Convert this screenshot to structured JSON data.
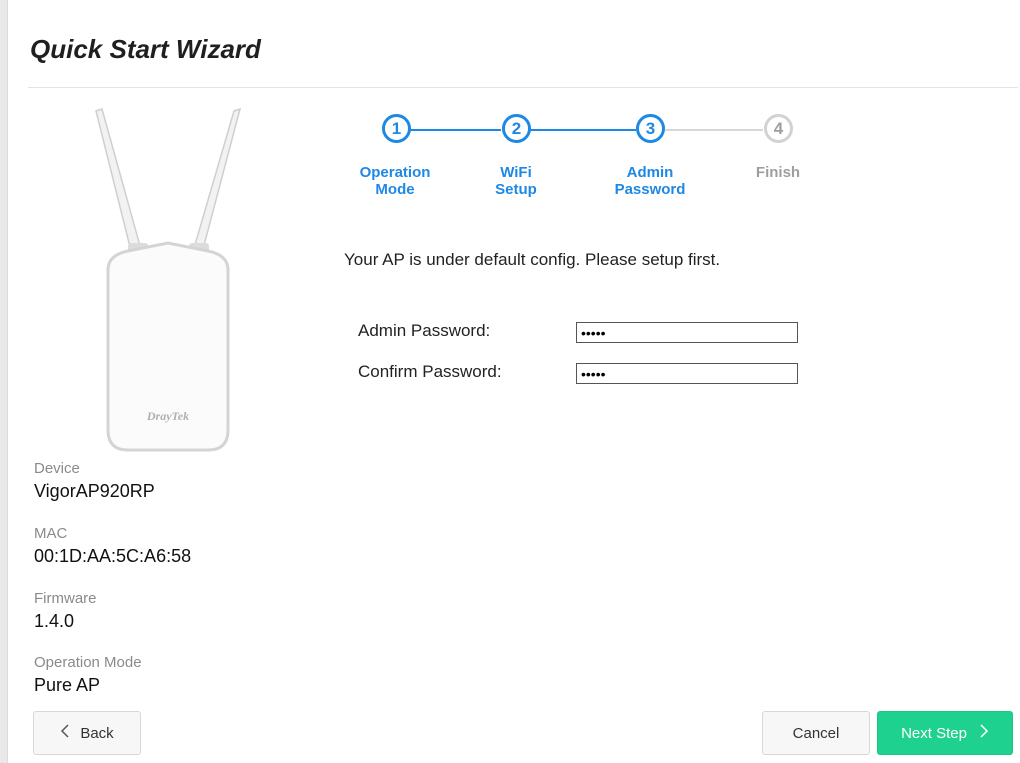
{
  "header": {
    "title": "Quick Start Wizard"
  },
  "device_image": {
    "brand": "DrayTek"
  },
  "info": [
    {
      "label": "Device",
      "value": "VigorAP920RP"
    },
    {
      "label": "MAC",
      "value": "00:1D:AA:5C:A6:58"
    },
    {
      "label": "Firmware",
      "value": "1.4.0"
    },
    {
      "label": "Operation Mode",
      "value": "Pure AP"
    }
  ],
  "steps": [
    {
      "number": "1",
      "label_line1": "Operation",
      "label_line2": "Mode",
      "state": "active"
    },
    {
      "number": "2",
      "label_line1": "WiFi",
      "label_line2": "Setup",
      "state": "active"
    },
    {
      "number": "3",
      "label_line1": "Admin",
      "label_line2": "Password",
      "state": "active"
    },
    {
      "number": "4",
      "label_line1": "Finish",
      "label_line2": "",
      "state": "inactive"
    }
  ],
  "intro": "Your AP is under default config. Please setup first.",
  "form": {
    "admin_password_label": "Admin Password:",
    "admin_password_value": "•••••",
    "confirm_password_label": "Confirm Password:",
    "confirm_password_value": "•••••"
  },
  "buttons": {
    "back": "Back",
    "cancel": "Cancel",
    "next": "Next Step"
  },
  "colors": {
    "accent": "#1e88e5",
    "next_button": "#1fd18f",
    "inactive": "#9e9e9e"
  },
  "icons": {
    "back": "chevron-left-icon",
    "next": "chevron-right-icon"
  }
}
